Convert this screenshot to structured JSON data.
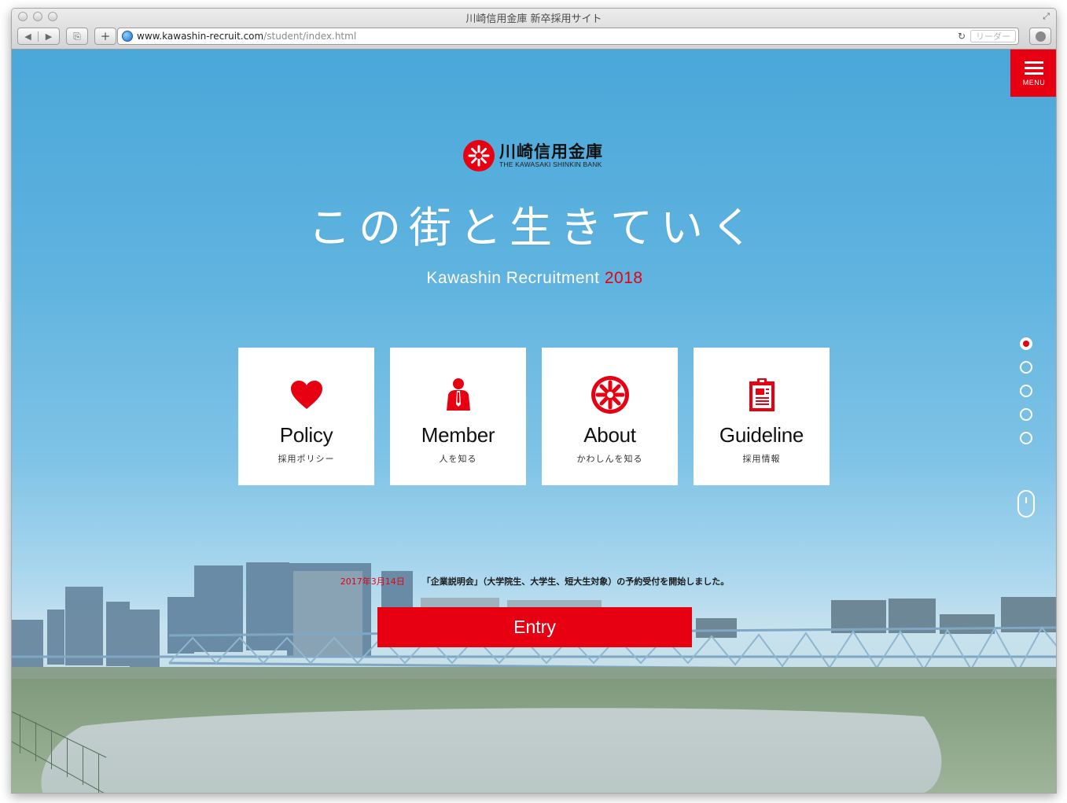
{
  "browser": {
    "window_title": "川崎信用金庫 新卒採用サイト",
    "url_host": "www.kawashin-recruit.com",
    "url_path": "/student/index.html",
    "reader_label": "リーダー",
    "back_glyph": "◀",
    "forward_glyph": "▶",
    "share_glyph": "⎘",
    "plus_glyph": "+",
    "reload_glyph": "↻",
    "resize_glyph": "⤢"
  },
  "page": {
    "menu_label": "MENU",
    "logo": {
      "jp": "川崎信用金庫",
      "en": "THE KAWASAKI SHINKIN BANK"
    },
    "headline": "この街と生きていく",
    "subhead": {
      "text": "Kawashin Recruitment",
      "year": "2018"
    },
    "cards": [
      {
        "title": "Policy",
        "sub": "採用ポリシー",
        "icon": "heart-icon"
      },
      {
        "title": "Member",
        "sub": "人を知る",
        "icon": "person-icon"
      },
      {
        "title": "About",
        "sub": "かわしんを知る",
        "icon": "kawashin-logo-icon"
      },
      {
        "title": "Guideline",
        "sub": "採用情報",
        "icon": "clipboard-icon"
      }
    ],
    "section_dots": {
      "count": 5,
      "active_index": 0
    },
    "news": {
      "date": "2017年3月14日",
      "text": "「企業説明会」（大学院生、大学生、短大生対象）の予約受付を開始しました。"
    },
    "entry_label": "Entry"
  },
  "colors": {
    "brand_red": "#e60012",
    "sky_top": "#4aa7d9",
    "card_bg": "#ffffff"
  }
}
